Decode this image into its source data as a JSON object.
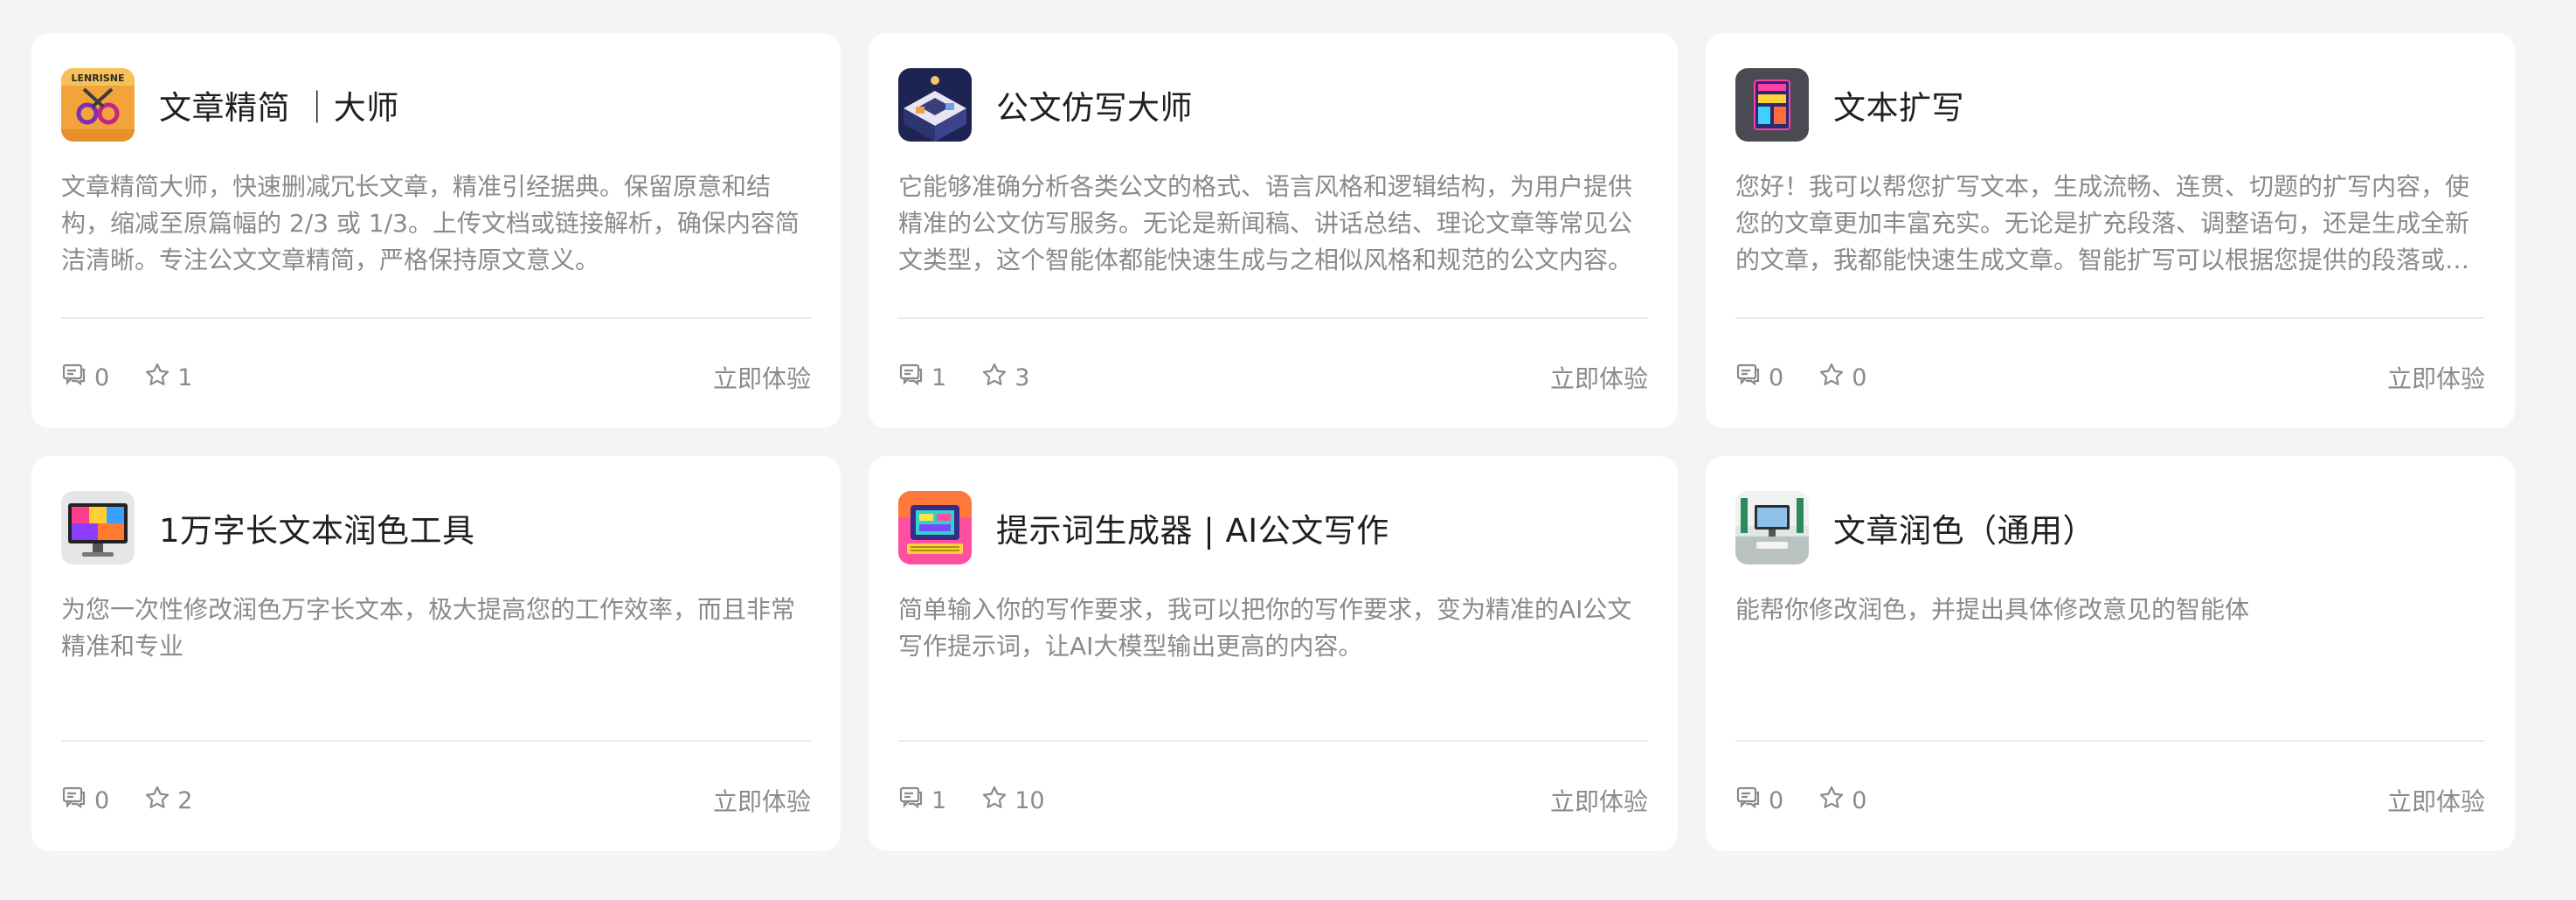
{
  "cards": [
    {
      "title": "文章精简 ｜大师",
      "description": "文章精简大师，快速删减冗长文章，精准引经据典。保留原意和结构，缩减至原篇幅的 2/3 或 1/3。上传文档或链接解析，确保内容简洁清晰。专注公文文章精简，严格保持原文意义。",
      "comments": "0",
      "stars": "1",
      "cta": "立即体验",
      "avatar_icon": "scissors-art-icon",
      "avatar_text": "LENRISNE"
    },
    {
      "title": "公文仿写大师",
      "description": "它能够准确分析各类公文的格式、语言风格和逻辑结构，为用户提供精准的公文仿写服务。无论是新闻稿、讲话总结、理论文章等常见公文类型，这个智能体都能快速生成与之相似风格和规范的公文内容。",
      "comments": "1",
      "stars": "3",
      "cta": "立即体验",
      "avatar_icon": "isometric-desk-icon"
    },
    {
      "title": "文本扩写",
      "description": "您好！我可以帮您扩写文本，生成流畅、连贯、切题的扩写内容，使您的文章更加丰富充实。无论是扩充段落、调整语句，还是生成全新的文章，我都能快速生成文章。智能扩写可以根据您提供的段落或句子，自动生成更加详细的内容。",
      "comments": "0",
      "stars": "0",
      "cta": "立即体验",
      "avatar_icon": "neon-sign-icon"
    },
    {
      "title": "1万字长文本润色工具",
      "description": "为您一次性修改润色万字长文本，极大提高您的工作效率，而且非常精准和专业",
      "comments": "0",
      "stars": "2",
      "cta": "立即体验",
      "avatar_icon": "colorful-monitor-icon"
    },
    {
      "title": "提示词生成器 | AI公文写作",
      "description": "简单输入你的写作要求，我可以把你的写作要求，变为精准的AI公文写作提示词，让AI大模型输出更高的内容。",
      "comments": "1",
      "stars": "10",
      "cta": "立即体验",
      "avatar_icon": "retro-computer-icon"
    },
    {
      "title": "文章润色（通用）",
      "description": "能帮你修改润色，并提出具体修改意见的智能体",
      "comments": "0",
      "stars": "0",
      "cta": "立即体验",
      "avatar_icon": "office-desk-icon"
    }
  ],
  "colors": {
    "page_bg": "#f4f4f5",
    "card_bg": "#ffffff",
    "title": "#1f1f1f",
    "muted": "#8a8a8a",
    "divider": "#ececec"
  }
}
